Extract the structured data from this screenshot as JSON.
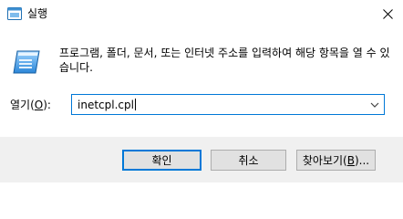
{
  "window": {
    "title": "실행",
    "title_icon": "run-icon",
    "close_icon": "close-icon"
  },
  "body": {
    "description": "프로그램, 폴더, 문서, 또는 인터넷 주소를 입력하여 해당 항목을 열 수 있습니다.",
    "run_icon": "run-dialog-icon"
  },
  "open": {
    "label_prefix": "열기(",
    "label_mnemonic": "O",
    "label_suffix": "):",
    "value": "inetcpl.cpl",
    "dropdown_icon": "chevron-down-icon"
  },
  "buttons": {
    "ok": "확인",
    "cancel": "취소",
    "browse_prefix": "찾아보기(",
    "browse_mnemonic": "B",
    "browse_suffix": ")..."
  },
  "colors": {
    "accent": "#0078d7",
    "button_strip": "#f0f0f0",
    "button_face": "#e1e1e1"
  }
}
